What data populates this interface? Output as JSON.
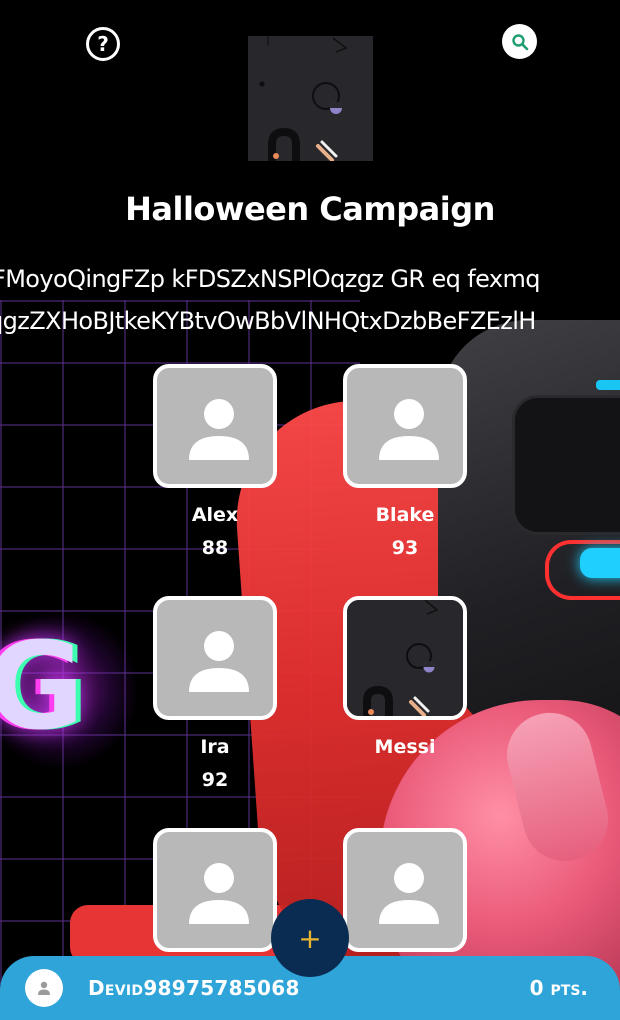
{
  "header": {
    "help_icon": "question-circle-icon",
    "search_icon": "search-icon",
    "campaign_image": "campaign-art"
  },
  "campaign": {
    "title": "Halloween Campaign",
    "description_line1": "FMoyoQingFZp kFDSZxNSPlOqzgz GR eq fexmq",
    "description_line2": "qgzZXHoBJtkeKYBtvOwBbVlNHQtxDzbBeFZEzlH"
  },
  "players": [
    {
      "name": "Alex",
      "score": "88",
      "avatar": "default-avatar"
    },
    {
      "name": "Blake",
      "score": "93",
      "avatar": "default-avatar"
    },
    {
      "name": "Ira",
      "score": "92",
      "avatar": "default-avatar"
    },
    {
      "name": "Messi",
      "score": "",
      "avatar": "custom-art"
    },
    {
      "name": "",
      "score": "",
      "avatar": "default-avatar"
    },
    {
      "name": "",
      "score": "",
      "avatar": "default-avatar"
    }
  ],
  "fab": {
    "label": "+",
    "color": "#e8b531"
  },
  "footer": {
    "username": "Devid98975785068",
    "points": "0 pts."
  },
  "colors": {
    "bottom_bar": "#2ea4d8",
    "fab_bg": "#0a2b52",
    "search_icon": "#1f9e6f",
    "tile_border": "#ffffff",
    "tile_placeholder": "#b8b8b8"
  }
}
